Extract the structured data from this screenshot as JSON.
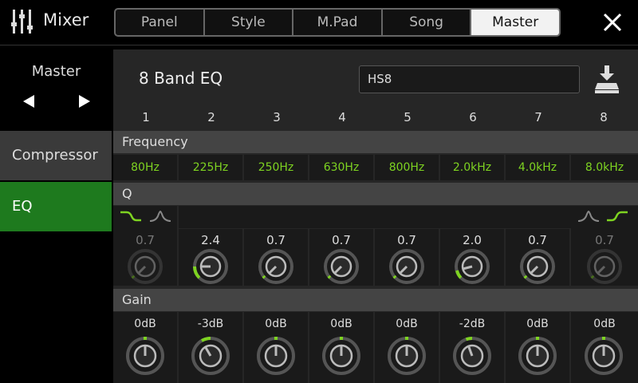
{
  "header": {
    "title": "Mixer",
    "tabs": [
      "Panel",
      "Style",
      "M.Pad",
      "Song",
      "Master"
    ],
    "active_tab": "Master"
  },
  "left": {
    "part_label": "Master",
    "nav": [
      {
        "label": "Compressor",
        "active": false
      },
      {
        "label": "EQ",
        "active": true
      }
    ]
  },
  "eq": {
    "title": "8 Band EQ",
    "preset": "HS8",
    "bands": [
      "1",
      "2",
      "3",
      "4",
      "5",
      "6",
      "7",
      "8"
    ],
    "sections": {
      "frequency": "Frequency",
      "q": "Q",
      "gain": "Gain"
    },
    "frequencies": [
      "80Hz",
      "225Hz",
      "250Hz",
      "630Hz",
      "800Hz",
      "2.0kHz",
      "4.0kHz",
      "8.0kHz"
    ],
    "q_values": [
      "0.7",
      "2.4",
      "0.7",
      "0.7",
      "0.7",
      "2.0",
      "0.7",
      "0.7"
    ],
    "gains": [
      "0dB",
      "-3dB",
      "0dB",
      "0dB",
      "0dB",
      "-2dB",
      "0dB",
      "0dB"
    ]
  },
  "colors": {
    "accent": "#7ed321",
    "active_nav": "#1e7a1e",
    "panel": "#262626"
  }
}
